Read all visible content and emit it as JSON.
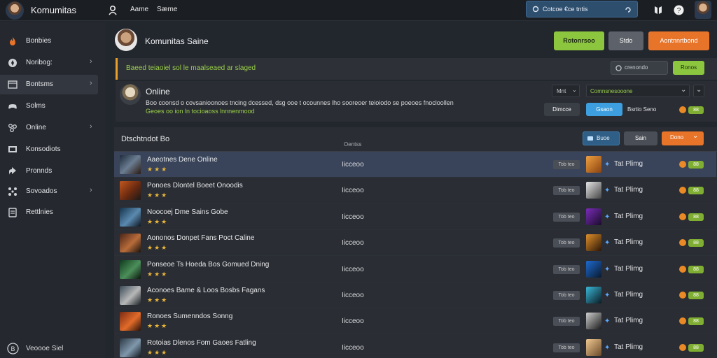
{
  "topbar": {
    "brand": "Komumitas",
    "nav": [
      "Aame",
      "Sæme"
    ],
    "search_text": "Cotcoe €ce tntis"
  },
  "sidebar": {
    "items": [
      {
        "label": "Bonbies",
        "icon": "fire-icon",
        "chevron": false,
        "active": false
      },
      {
        "label": "Noribog:",
        "icon": "compass-icon",
        "chevron": true,
        "active": false
      },
      {
        "label": "Bontsms",
        "icon": "window-icon",
        "chevron": true,
        "active": true
      },
      {
        "label": "Solms",
        "icon": "controller-icon",
        "chevron": false,
        "active": false
      },
      {
        "label": "Online",
        "icon": "network-icon",
        "chevron": true,
        "active": false
      },
      {
        "label": "Konsodiots",
        "icon": "monitor-icon",
        "chevron": false,
        "active": false
      },
      {
        "label": "Pronnds",
        "icon": "share-icon",
        "chevron": false,
        "active": false
      },
      {
        "label": "Sovoados",
        "icon": "nodes-icon",
        "chevron": true,
        "active": false
      },
      {
        "label": "Rettlnies",
        "icon": "settings-icon",
        "chevron": false,
        "active": false
      }
    ],
    "footer": "Veoooe Siel"
  },
  "header": {
    "title": "Komunitas Saine",
    "btn_green": "Rotonrsoo",
    "btn_gray": "Stdo",
    "btn_orange": "Aontnnrtbond"
  },
  "notice": {
    "text": "Baeed teiaoiel sol le maalseaed ar slaged",
    "select_label": "crenondo",
    "btn": "Ronos"
  },
  "online": {
    "title": "Online",
    "desc": "Boo coonsd o covsanioonoes tncing dcessed, dsg ooe t ocounnes lho sooreoer teioiodo se poeoes fnocloollen",
    "link": "Geoes oo ion ln tocioaoss lnnnenmood",
    "filter_label": "Mnt",
    "dropdown": "Comnsnesooone",
    "btn_dark": "Dimcce",
    "btn_blue": "Gsaon",
    "filter_text": "Bsrtio Seno",
    "count": "88"
  },
  "list": {
    "heading": "Dtschtndot Bo",
    "col_label": "Oentss",
    "btn_blue": "Buoe",
    "btn_gray": "Sain",
    "btn_orange": "Dono",
    "rows": [
      {
        "title": "Aaeotnes Dene Online",
        "status": "Iicceoo",
        "tag": "Tob teo",
        "playing": "Tat Plimg",
        "count": "88"
      },
      {
        "title": "Ponoes Dlontel Boeet Onoodis",
        "status": "Iicceoo",
        "tag": "Tob teo",
        "playing": "Tat Plimg",
        "count": "88"
      },
      {
        "title": "Noocoej Dme Sains Gobe",
        "status": "Iicceoo",
        "tag": "Tob teo",
        "playing": "Tat Plimg",
        "count": "88"
      },
      {
        "title": "Aononos Donpet Fans Poct Caline",
        "status": "Iicceoo",
        "tag": "Tob teo",
        "playing": "Tat Plimg",
        "count": "88"
      },
      {
        "title": "Ponseoe Ts Hoeda Bos Gomued Dning",
        "status": "Iicceoo",
        "tag": "Tob teo",
        "playing": "Tat Plimg",
        "count": "88"
      },
      {
        "title": "Aconoes Bame & Loos Bosbs Fagans",
        "status": "Iicceoo",
        "tag": "Tob teo",
        "playing": "Tat Plimg",
        "count": "88"
      },
      {
        "title": "Ronoes Sumenndos Sonng",
        "status": "Iicceoo",
        "tag": "Tob teo",
        "playing": "Tat Plimg",
        "count": "88"
      },
      {
        "title": "Rotoias Dlenos Fom Gaoes Fatling",
        "status": "Iicceoo",
        "tag": "Tob teo",
        "playing": "Tat Plimg",
        "count": "88"
      }
    ]
  },
  "colors": {
    "accent_green": "#8cc63f",
    "accent_orange": "#e8742a",
    "accent_blue": "#3e9fe0"
  }
}
